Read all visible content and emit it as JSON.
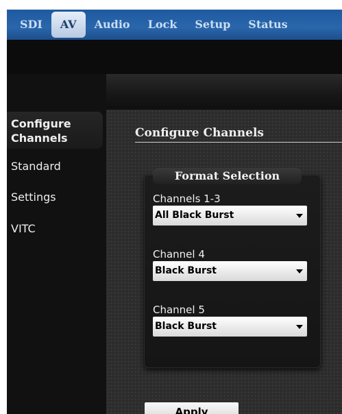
{
  "nav": {
    "tabs": [
      {
        "label": "SDI"
      },
      {
        "label": "AV"
      },
      {
        "label": "Audio"
      },
      {
        "label": "Lock"
      },
      {
        "label": "Setup"
      },
      {
        "label": "Status"
      }
    ],
    "active": "AV"
  },
  "sidebar": {
    "items": [
      {
        "label": "Configure Channels"
      },
      {
        "label": "Standard"
      },
      {
        "label": "Settings"
      },
      {
        "label": "VITC"
      }
    ]
  },
  "main": {
    "section_title": "Configure Channels",
    "panel_title": "Format Selection",
    "channels": [
      {
        "label": "Channels 1-3",
        "value": "All Black Burst"
      },
      {
        "label": "Channel 4",
        "value": "Black Burst"
      },
      {
        "label": "Channel 5",
        "value": "Black Burst"
      }
    ],
    "apply_label": "Apply"
  }
}
